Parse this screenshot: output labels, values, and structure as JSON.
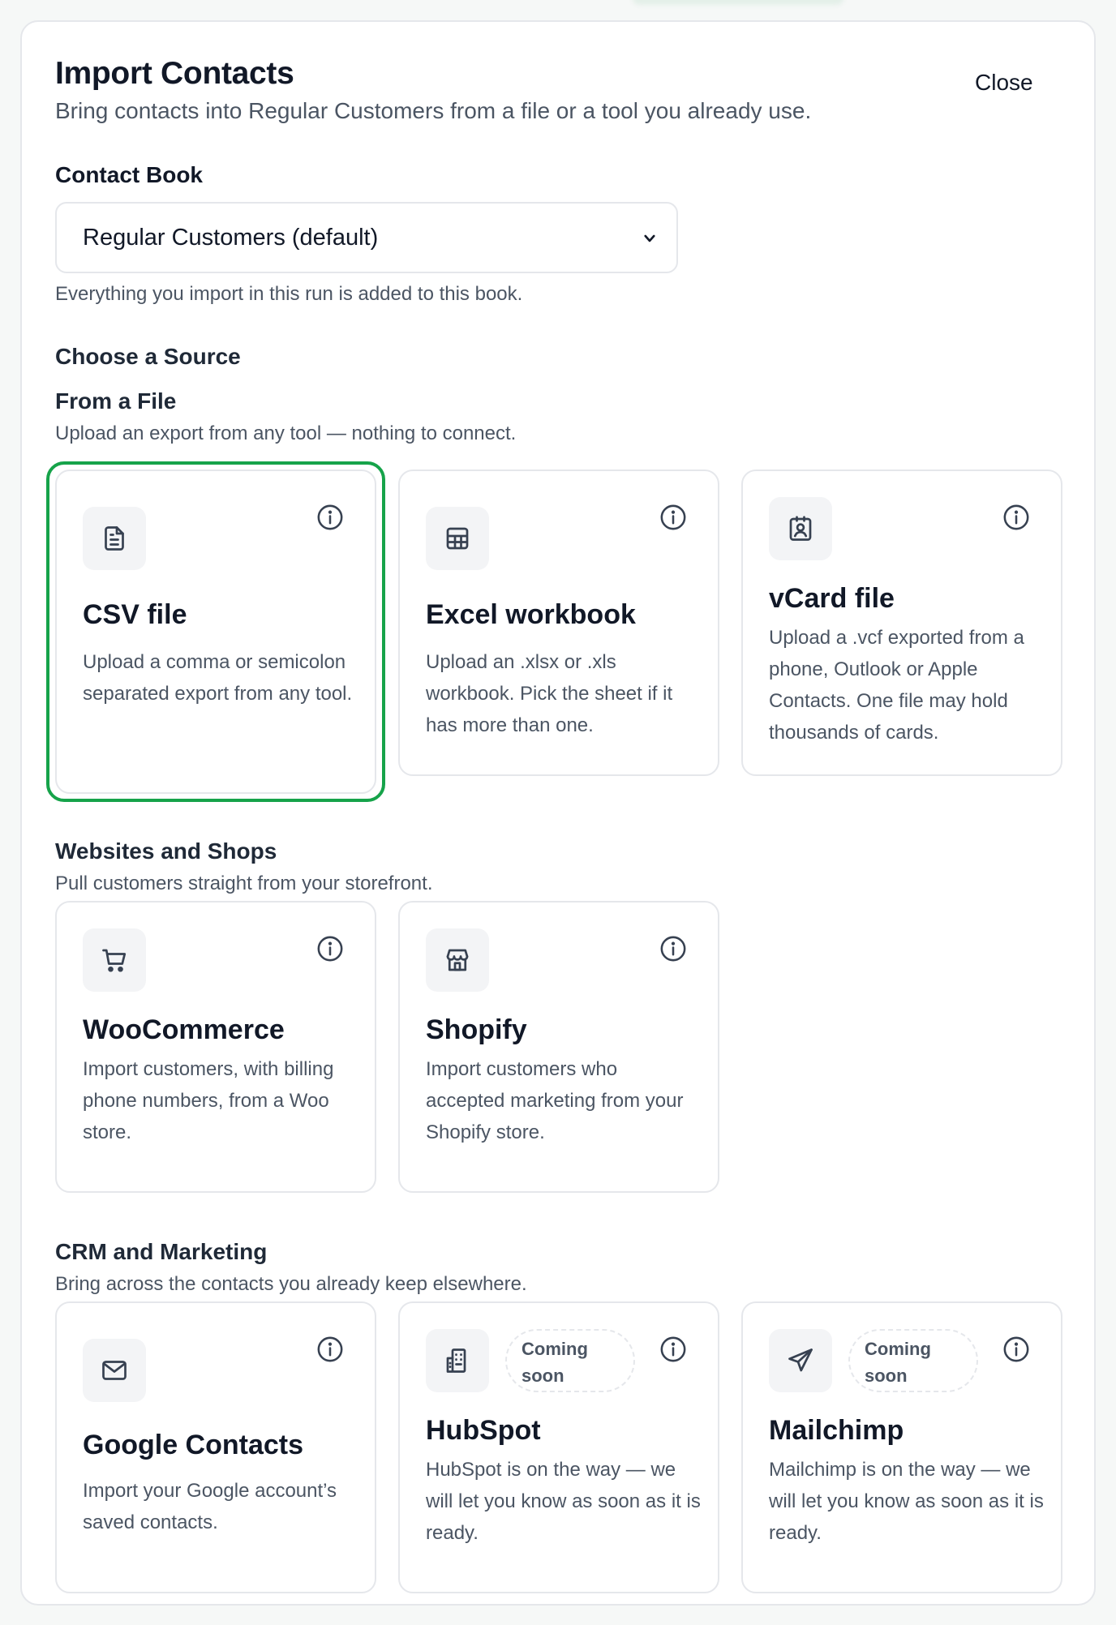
{
  "header": {
    "title": "Import Contacts",
    "subtitle": "Bring contacts into Regular Customers from a file or a tool you already use.",
    "close_label": "Close"
  },
  "contact_book": {
    "label": "Contact Book",
    "selected": "Regular Customers (default)",
    "hint": "Everything you import in this run is added to this book."
  },
  "choose_source_label": "Choose a Source",
  "groups": [
    {
      "title": "From a File",
      "desc": "Upload an export from any tool — nothing to connect.",
      "cards": [
        {
          "icon": "document-icon",
          "title": "CSV file",
          "desc": "Upload a comma or semicolon separated export from any tool.",
          "selected": true
        },
        {
          "icon": "table-icon",
          "title": "Excel workbook",
          "desc": "Upload an .xlsx or .xls workbook. Pick the sheet if it has more than one."
        },
        {
          "icon": "contact-card-icon",
          "title": "vCard file",
          "desc": "Upload a .vcf exported from a phone, Outlook or Apple Contacts. One file may hold thousands of cards."
        }
      ]
    },
    {
      "title": "Websites and Shops",
      "desc": "Pull customers straight from your storefront.",
      "cards": [
        {
          "icon": "cart-icon",
          "title": "WooCommerce",
          "desc": "Import customers, with billing phone numbers, from a Woo store."
        },
        {
          "icon": "store-icon",
          "title": "Shopify",
          "desc": "Import customers who accepted marketing from your Shopify store."
        }
      ]
    },
    {
      "title": "CRM and Marketing",
      "desc": "Bring across the contacts you already keep elsewhere.",
      "cards": [
        {
          "icon": "mail-icon",
          "title": "Google Contacts",
          "desc": "Import your Google account’s saved contacts."
        },
        {
          "icon": "building-icon",
          "title": "HubSpot",
          "badge": "Coming soon",
          "desc": "HubSpot is on the way — we will let you know as soon as it is ready."
        },
        {
          "icon": "send-icon",
          "title": "Mailchimp",
          "badge": "Coming soon",
          "desc": "Mailchimp is on the way — we will let you know as soon as it is ready."
        }
      ]
    }
  ],
  "colors": {
    "selected_border": "#16a34a",
    "text_muted": "#4b5563",
    "card_border": "#e5e7eb"
  }
}
